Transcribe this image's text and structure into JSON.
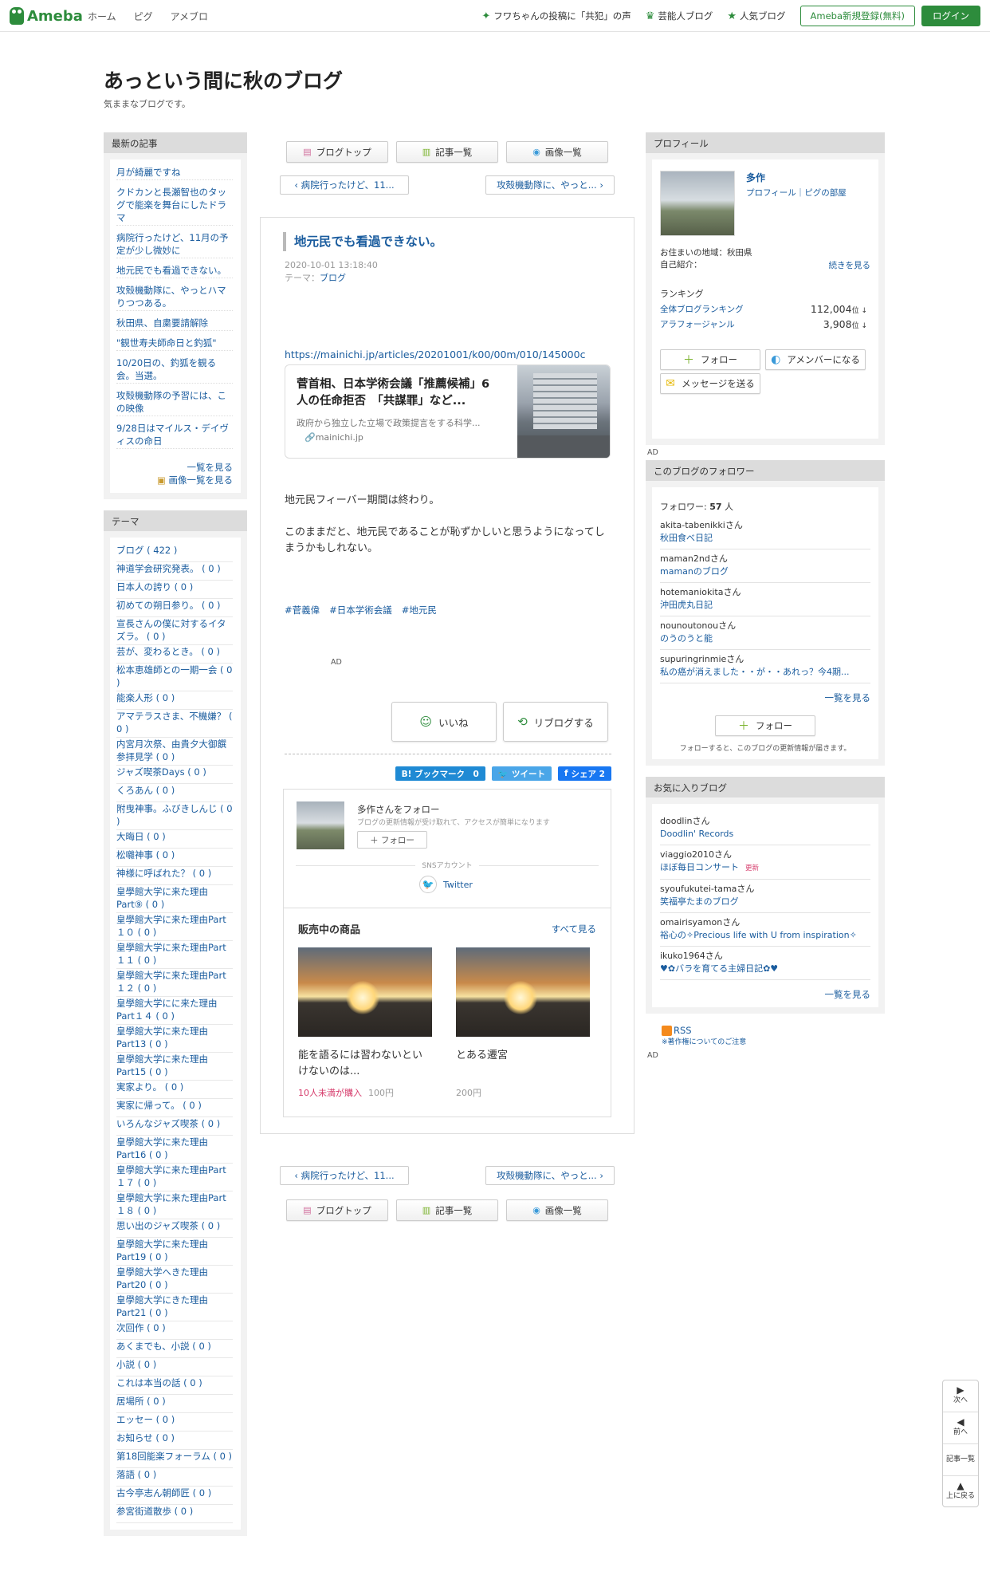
{
  "header": {
    "logo": "Ameba",
    "nav_left": [
      "ホーム",
      "ピグ",
      "アメブロ"
    ],
    "nav_right": [
      {
        "icon": "sparkle-icon",
        "label": "フワちゃんの投稿に「共犯」の声"
      },
      {
        "icon": "crown-icon",
        "label": "芸能人ブログ"
      },
      {
        "icon": "star-icon",
        "label": "人気ブログ"
      }
    ],
    "register": "Ameba新規登録(無料)",
    "login": "ログイン"
  },
  "blog": {
    "title": "あっという間に秋のブログ",
    "description": "気ままなブログです。"
  },
  "recent": {
    "heading": "最新の記事",
    "items": [
      "月が綺麗ですね",
      "クドカンと長瀬智也のタッグで能楽を舞台にしたドラマ",
      "病院行ったけど、11月の予定が少し微妙に",
      "地元民でも看過できない。",
      "攻殻機動隊に、やっとハマりつつある。",
      "秋田県、自粛要請解除",
      "\"観世寿夫師命日と釣狐\"",
      "10/20日の、釣狐を観る会。当選。",
      "攻殻機動隊の予習には、この映像",
      "9/28日はマイルス・デイヴィスの命日"
    ],
    "more": "一覧を見る",
    "images": "画像一覧を見る"
  },
  "themes": {
    "heading": "テーマ",
    "items": [
      "ブログ ( 422 )",
      "神道学会研究発表。 ( 0 )",
      "日本人の誇り ( 0 )",
      "初めての朔日参り。 ( 0 )",
      "宣長さんの僕に対するイタズラ。 ( 0 )",
      "芸が、変わるとき。 ( 0 )",
      "松本恵雄師との一期一会 ( 0 )",
      "能楽人形 ( 0 )",
      "アマテラスさま、不機嫌？ ( 0 )",
      "内宮月次祭、由貴夕大御饌参拝見学 ( 0 )",
      "ジャズ喫茶Days ( 0 )",
      "くろあん ( 0 )",
      "附曳神事。ふびきしんじ ( 0 )",
      "大晦日 ( 0 )",
      "松囃神事 ( 0 )",
      "神様に呼ばれた？ ( 0 )",
      "皇學館大学に来た理由Part⑨ ( 0 )",
      "皇學館大学に来た理由Part１０ ( 0 )",
      "皇學館大学に来た理由Part１１ ( 0 )",
      "皇學館大学に来た理由Part１２ ( 0 )",
      "皇學館大学にに来た理由Part１４ ( 0 )",
      "皇學館大学に来た理由Part13 ( 0 )",
      "皇學館大学に来た理由Part15 ( 0 )",
      "実家より。 ( 0 )",
      "実家に帰って。 ( 0 )",
      "いろんなジャズ喫茶 ( 0 )",
      "皇學館大学に来た理由Part16 ( 0 )",
      "皇學館大学に来た理由Part１７ ( 0 )",
      "皇學館大学に来た理由Part１８ ( 0 )",
      "思い出のジャズ喫茶 ( 0 )",
      "皇學館大学に来た理由Part19 ( 0 )",
      "皇學館大学へきた理由Part20 ( 0 )",
      "皇學館大学にきた理由Part21 ( 0 )",
      "次回作 ( 0 )",
      "あくまでも、小説 ( 0 )",
      "小説 ( 0 )",
      "これは本当の話 ( 0 )",
      "居場所 ( 0 )",
      "エッセー ( 0 )",
      "お知らせ ( 0 )",
      "第18回能楽フォーラム ( 0 )",
      "落語 ( 0 )",
      "古今亭志ん朝師匠 ( 0 )",
      "参宮街道散歩 ( 0 )"
    ]
  },
  "tabs": [
    {
      "icon": "page-icon",
      "label": "ブログトップ"
    },
    {
      "icon": "list-icon",
      "label": "記事一覧"
    },
    {
      "icon": "camera-icon",
      "label": "画像一覧"
    }
  ],
  "pager": {
    "prev": "‹ 病院行ったけど、11...",
    "next": "攻殻機動隊に、やっと... ›"
  },
  "article": {
    "title": "地元民でも看過できない。",
    "date": "2020-10-01 13:18:40",
    "theme_label": "テーマ：",
    "theme": "ブログ",
    "link": "https://mainichi.jp/articles/20201001/k00/00m/010/145000c",
    "card": {
      "title": "菅首相、日本学術会議「推薦候補」6人の任命拒否　「共謀罪」など...",
      "desc": "政府から独立した立場で政策提言をする科学...",
      "domain": "mainichi.jp"
    },
    "p1": "地元民フィーバー期間は終わり。",
    "p2": "このままだと、地元民であることが恥ずかしいと思うようになってしまうかもしれない。",
    "tags": [
      "#菅義偉",
      "#日本学術会議",
      "#地元民"
    ],
    "ad": "AD",
    "like": "いいね",
    "reblog": "リブログする"
  },
  "share": {
    "hatena": "B! ブックマーク　0",
    "tweet": "ツイート",
    "fb": "シェア 2"
  },
  "follow": {
    "title": "多作さんをフォロー",
    "sub": "ブログの更新情報が受け取れて、アクセスが簡単になります",
    "btn": "＋ フォロー",
    "sns": "SNSアカウント",
    "twitter": "Twitter"
  },
  "shop": {
    "title": "販売中の商品",
    "all": "すべて見る",
    "items": [
      {
        "name": "能を語るには習わないといけないのは...",
        "sold": "10人未満が購入",
        "price": "100円"
      },
      {
        "name": "とある遷宮",
        "sold": "",
        "price": "200円"
      }
    ]
  },
  "profile": {
    "heading": "プロフィール",
    "name": "多作",
    "links": "プロフィール｜ピグの部屋",
    "residence": "お住まいの地域：秋田県",
    "intro": "自己紹介：",
    "continue": "続きを見る",
    "ranking": "ランキング",
    "rank1_name": "全体ブログランキング",
    "rank1_val": "112,004",
    "rank2_name": "アラフォージャンル",
    "rank2_val": "3,908",
    "rank_unit": "位 ↓",
    "follow": "フォロー",
    "amember": "アメンバーになる",
    "message": "メッセージを送る"
  },
  "followers": {
    "heading": "このブログのフォロワー",
    "count_label": "フォロワー: ",
    "count": "57",
    "count_unit": " 人",
    "items": [
      {
        "user": "akita-tabenikkiさん",
        "blog": "秋田食べ日記"
      },
      {
        "user": "maman2ndさん",
        "blog": "mamanのブログ"
      },
      {
        "user": "hotemaniokitaさん",
        "blog": "沖田虎丸日記"
      },
      {
        "user": "nounoutonouさん",
        "blog": "のうのうと能"
      },
      {
        "user": "supuringrinmieさん",
        "blog": "私の癌が消えました・・が・・あれっ？今4期..."
      }
    ],
    "more": "一覧を見る",
    "follow": "フォロー",
    "note": "フォローすると、このブログの更新情報が届きます。"
  },
  "favorites": {
    "heading": "お気に入りブログ",
    "items": [
      {
        "user": "doodlinさん",
        "blog": "Doodlin' Records",
        "up": ""
      },
      {
        "user": "viaggio2010さん",
        "blog": "ほぼ毎日コンサート",
        "up": "更新"
      },
      {
        "user": "syoufukutei-tamaさん",
        "blog": "笑福亭たまのブログ",
        "up": ""
      },
      {
        "user": "omairisyamonさん",
        "blog": "裕心の✧Precious life with U from inspiration✧",
        "up": ""
      },
      {
        "user": "ikuko1964さん",
        "blog": "♥✿バラを育てる主婦日記✿♥",
        "up": ""
      }
    ],
    "more": "一覧を見る"
  },
  "rss": {
    "label": "RSS",
    "note": "※著作権についてのご注意"
  },
  "float": {
    "next": "次へ",
    "prev": "前へ",
    "list": "記事一覧",
    "top": "上に戻る"
  }
}
